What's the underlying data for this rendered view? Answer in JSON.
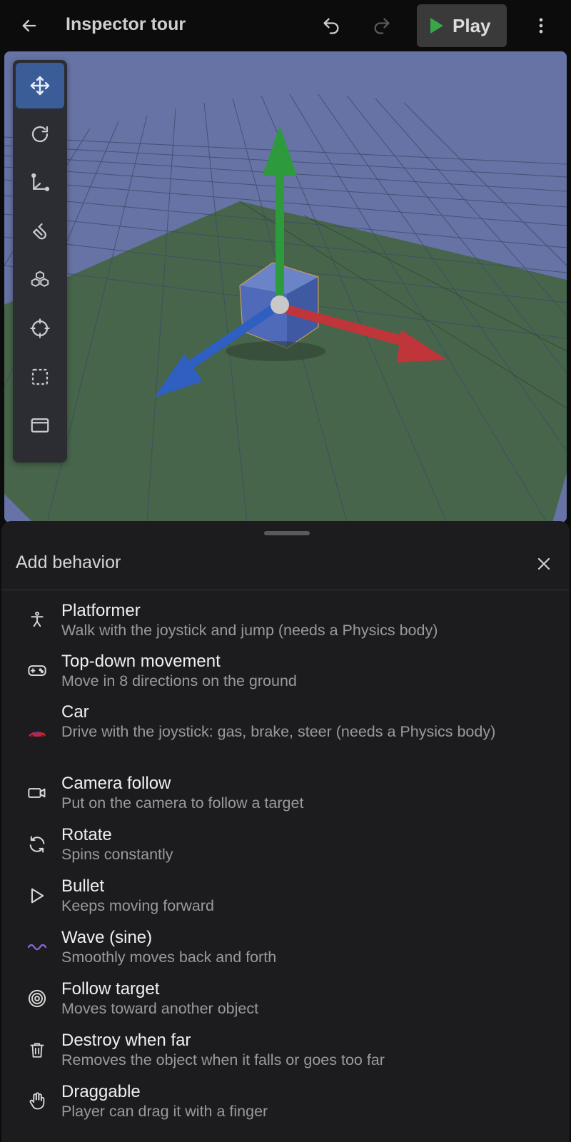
{
  "header": {
    "title": "Inspector tour",
    "play_label": "Play"
  },
  "toolrail": {
    "tools": [
      {
        "name": "move-tool",
        "active": true
      },
      {
        "name": "rotate-tool",
        "active": false
      },
      {
        "name": "scale-tool",
        "active": false
      },
      {
        "name": "snap-tool",
        "active": false
      },
      {
        "name": "add-object-tool",
        "active": false
      },
      {
        "name": "focus-tool",
        "active": false
      },
      {
        "name": "select-area-tool",
        "active": false
      },
      {
        "name": "window-tool",
        "active": false
      }
    ]
  },
  "sheet": {
    "title": "Add behavior",
    "items": [
      {
        "name": "Platformer",
        "desc": "Walk with the joystick and jump (needs a Physics body)",
        "icon": "person-icon"
      },
      {
        "name": "Top-down movement",
        "desc": "Move in 8 directions on the ground",
        "icon": "gamepad-icon"
      },
      {
        "name": "Car",
        "desc": "Drive with the joystick: gas, brake, steer (needs a Physics body)",
        "icon": "race-car-icon"
      },
      {
        "name": "Camera follow",
        "desc": "Put on the camera to follow a target",
        "icon": "video-camera-icon"
      },
      {
        "name": "Rotate",
        "desc": "Spins constantly",
        "icon": "refresh-icon"
      },
      {
        "name": "Bullet",
        "desc": "Keeps moving forward",
        "icon": "play-outline-icon"
      },
      {
        "name": "Wave (sine)",
        "desc": "Smoothly moves back and forth",
        "icon": "wave-icon"
      },
      {
        "name": "Follow target",
        "desc": "Moves toward another object",
        "icon": "target-icon"
      },
      {
        "name": "Destroy when far",
        "desc": "Removes the object when it falls or goes too far",
        "icon": "trash-icon"
      },
      {
        "name": "Draggable",
        "desc": "Player can drag it with a finger",
        "icon": "hand-icon"
      }
    ]
  },
  "colors": {
    "sky": "#6673a4",
    "ground": "#47654a",
    "axis_x": "#c0353a",
    "axis_y": "#2e9a3e",
    "axis_z": "#2f5fc0",
    "accent": "#3a5c97"
  }
}
